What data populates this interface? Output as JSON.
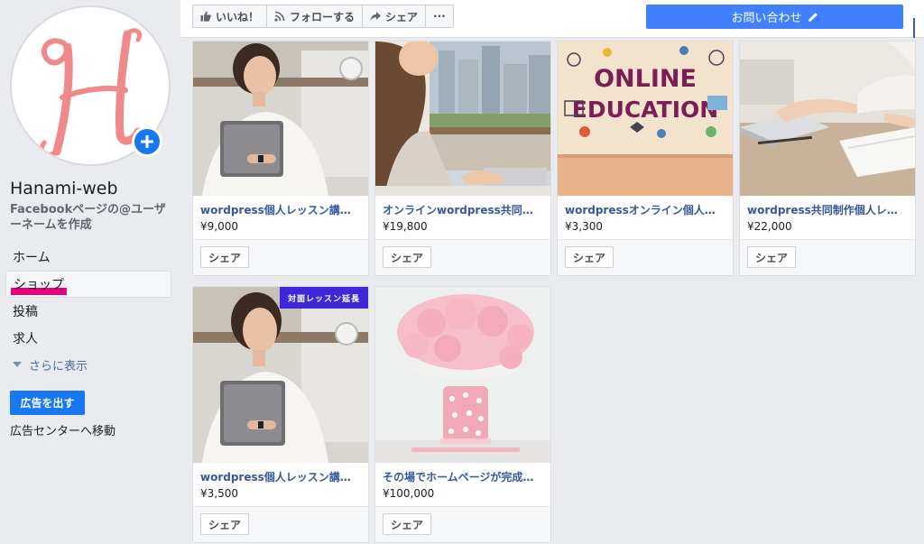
{
  "page": {
    "name": "Hanami-web",
    "username_link": "Facebookページの@ユーザーネームを作成",
    "avatar_letter": "H"
  },
  "nav": {
    "items": [
      {
        "label": "ホーム"
      },
      {
        "label": "ショップ"
      },
      {
        "label": "投稿"
      },
      {
        "label": "求人"
      }
    ],
    "see_more": "さらに表示",
    "promote": "広告を出す",
    "ad_center": "広告センターへ移動"
  },
  "topbar": {
    "like": "いいね！",
    "follow": "フォローする",
    "share": "シェア",
    "more": "···",
    "contact": "お問い合わせ"
  },
  "products": [
    {
      "title": "wordpress個人レッスン講座6…",
      "price": "¥9,000",
      "share": "シェア",
      "image": "woman-with-laptop-photo"
    },
    {
      "title": "オンラインwordpress共同制作…",
      "price": "¥19,800",
      "share": "シェア",
      "image": "woman-typing-laptop-photo"
    },
    {
      "title": "wordpressオンライン個人レッ…",
      "price": "¥3,300",
      "share": "シェア",
      "image": "online-education-photo",
      "image_text": [
        "ONLINE",
        "EDUCATION"
      ]
    },
    {
      "title": "wordpress共同制作個人レッス…",
      "price": "¥22,000",
      "share": "シェア",
      "image": "hands-typing-laptop-photo"
    },
    {
      "title": "wordpress個人レッスン講座追…",
      "price": "¥3,500",
      "share": "シェア",
      "image": "woman-with-laptop-photo",
      "badge": "対面レッスン延長"
    },
    {
      "title": "その場でホームページが完成！…",
      "price": "¥100,000",
      "share": "シェア",
      "image": "pink-cake-photo"
    }
  ],
  "colors": {
    "facebook_blue": "#1877f2",
    "link_blue": "#365899",
    "highlight_magenta": "#e6007e",
    "contact_button": "#4080ff",
    "ribbon": "#3d27d9",
    "logo_pink": "#f08a8a"
  }
}
